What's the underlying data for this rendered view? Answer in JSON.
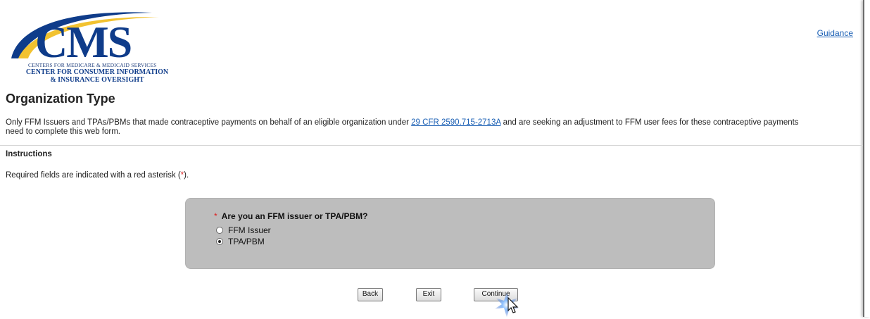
{
  "logo": {
    "main_text": "CMS",
    "subtitle1": "CENTERS FOR MEDICARE & MEDICAID SERVICES",
    "subtitle2": "CENTER FOR CONSUMER INFORMATION",
    "subtitle3": "& INSURANCE OVERSIGHT",
    "colors": {
      "navy": "#0f3c8a",
      "gold": "#f2c230"
    }
  },
  "header": {
    "guidance_link": "Guidance"
  },
  "page": {
    "title": "Organization Type",
    "intro_before": "Only FFM Issuers and TPAs/PBMs that made contraceptive payments on behalf of an eligible organization under ",
    "intro_link": "29 CFR 2590.715-2713A",
    "intro_after": " and are seeking an adjustment to FFM user fees for these contraceptive payments need to complete this web form."
  },
  "instructions": {
    "header": "Instructions",
    "required_before": "Required fields are indicated with a red asterisk (",
    "required_asterisk": "*",
    "required_after": ")."
  },
  "question": {
    "asterisk": "*",
    "label": "Are you an FFM issuer or TPA/PBM?",
    "options": [
      {
        "label": "FFM Issuer",
        "checked": false
      },
      {
        "label": "TPA/PBM",
        "checked": true
      }
    ]
  },
  "buttons": {
    "back": "Back",
    "exit": "Exit",
    "continue": "Continue"
  },
  "icons": {
    "cursor": "cursor-arrow-icon",
    "burst": "click-burst-icon"
  }
}
